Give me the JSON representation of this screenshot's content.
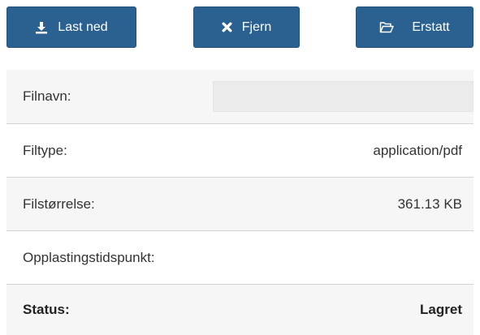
{
  "toolbar": {
    "download_label": "Last ned",
    "remove_label": "Fjern",
    "replace_label": "Erstatt"
  },
  "details": {
    "filename_label": "Filnavn:",
    "filename_value": "",
    "filetype_label": "Filtype:",
    "filetype_value": "application/pdf",
    "filesize_label": "Filstørrelse:",
    "filesize_value": "361.13 KB",
    "uploaded_label": "Opplastingstidspunkt:",
    "uploaded_value": "",
    "status_label": "Status:",
    "status_value": "Lagret"
  },
  "colors": {
    "button_bg": "#2b6190",
    "row_alt_bg": "#f6f6f6"
  },
  "icons": {
    "download": "download-icon",
    "remove": "close-icon",
    "replace": "folder-open-icon"
  }
}
